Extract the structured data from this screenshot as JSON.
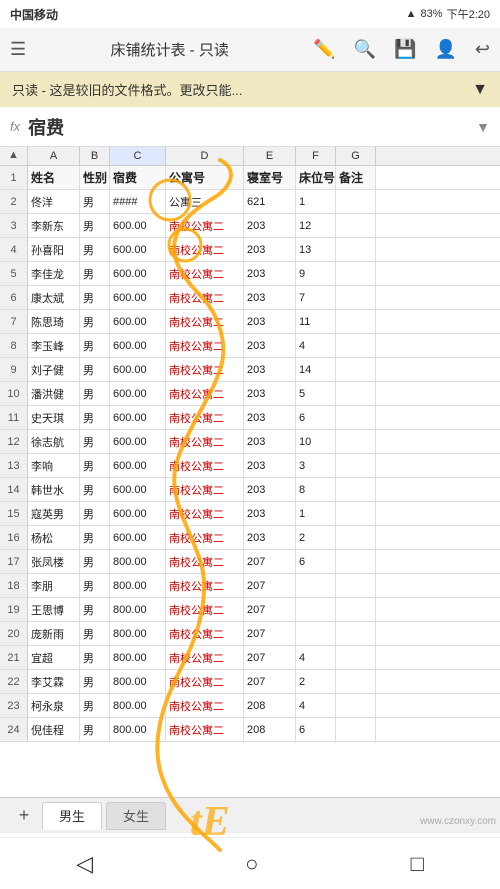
{
  "statusBar": {
    "carrier": "中国移动",
    "signal": "3G",
    "battery": "83%",
    "time": "下午2:20"
  },
  "titleBar": {
    "title": "床铺统计表 - 只读",
    "icons": [
      "edit",
      "search",
      "save",
      "user",
      "undo"
    ]
  },
  "readonlyBanner": {
    "text": "只读 - 这是较旧的文件格式。更改只能...",
    "expandIcon": "▼"
  },
  "formulaBar": {
    "fxLabel": "fx",
    "content": "宿费",
    "expandIcon": "▼"
  },
  "colHeaders": {
    "rowNum": "▲",
    "cols": [
      "A",
      "B",
      "C",
      "D",
      "E",
      "F",
      "G"
    ]
  },
  "rows": [
    {
      "num": "1",
      "a": "姓名",
      "b": "性别",
      "c": "宿费",
      "d": "公寓号",
      "e": "寝室号",
      "f": "床位号",
      "g": "备注",
      "header": true
    },
    {
      "num": "2",
      "a": "佟洋",
      "b": "男",
      "c": "####",
      "d": "公寓三",
      "e": "621",
      "f": "1",
      "g": ""
    },
    {
      "num": "3",
      "a": "李新东",
      "b": "男",
      "c": "600.00",
      "d": "南校公寓二",
      "e": "203",
      "f": "12",
      "g": ""
    },
    {
      "num": "4",
      "a": "孙喜阳",
      "b": "男",
      "c": "600.00",
      "d": "南校公寓二",
      "e": "203",
      "f": "13",
      "g": ""
    },
    {
      "num": "5",
      "a": "李佳龙",
      "b": "男",
      "c": "600.00",
      "d": "南校公寓二",
      "e": "203",
      "f": "9",
      "g": ""
    },
    {
      "num": "6",
      "a": "康太斌",
      "b": "男",
      "c": "600.00",
      "d": "南校公寓二",
      "e": "203",
      "f": "7",
      "g": ""
    },
    {
      "num": "7",
      "a": "陈思琦",
      "b": "男",
      "c": "600.00",
      "d": "南校公寓二",
      "e": "203",
      "f": "11",
      "g": ""
    },
    {
      "num": "8",
      "a": "李玉峰",
      "b": "男",
      "c": "600.00",
      "d": "南校公寓二",
      "e": "203",
      "f": "4",
      "g": ""
    },
    {
      "num": "9",
      "a": "刘子健",
      "b": "男",
      "c": "600.00",
      "d": "南校公寓二",
      "e": "203",
      "f": "14",
      "g": ""
    },
    {
      "num": "10",
      "a": "潘洪健",
      "b": "男",
      "c": "600.00",
      "d": "南校公寓二",
      "e": "203",
      "f": "5",
      "g": ""
    },
    {
      "num": "11",
      "a": "史天琪",
      "b": "男",
      "c": "600.00",
      "d": "南校公寓二",
      "e": "203",
      "f": "6",
      "g": ""
    },
    {
      "num": "12",
      "a": "徐志航",
      "b": "男",
      "c": "600.00",
      "d": "南校公寓二",
      "e": "203",
      "f": "10",
      "g": ""
    },
    {
      "num": "13",
      "a": "李响",
      "b": "男",
      "c": "600.00",
      "d": "南校公寓二",
      "e": "203",
      "f": "3",
      "g": ""
    },
    {
      "num": "14",
      "a": "韩世水",
      "b": "男",
      "c": "600.00",
      "d": "南校公寓二",
      "e": "203",
      "f": "8",
      "g": ""
    },
    {
      "num": "15",
      "a": "寇英男",
      "b": "男",
      "c": "600.00",
      "d": "南校公寓二",
      "e": "203",
      "f": "1",
      "g": ""
    },
    {
      "num": "16",
      "a": "杨松",
      "b": "男",
      "c": "600.00",
      "d": "南校公寓二",
      "e": "203",
      "f": "2",
      "g": ""
    },
    {
      "num": "17",
      "a": "张凤楼",
      "b": "男",
      "c": "800.00",
      "d": "南校公寓二",
      "e": "207",
      "f": "6",
      "g": ""
    },
    {
      "num": "18",
      "a": "李朋",
      "b": "男",
      "c": "800.00",
      "d": "南校公寓二",
      "e": "207",
      "f": "",
      "g": ""
    },
    {
      "num": "19",
      "a": "王思博",
      "b": "男",
      "c": "800.00",
      "d": "南校公寓二",
      "e": "207",
      "f": "",
      "g": ""
    },
    {
      "num": "20",
      "a": "庞新雨",
      "b": "男",
      "c": "800.00",
      "d": "南校公寓二",
      "e": "207",
      "f": "",
      "g": ""
    },
    {
      "num": "21",
      "a": "宜超",
      "b": "男",
      "c": "800.00",
      "d": "南校公寓二",
      "e": "207",
      "f": "4",
      "g": ""
    },
    {
      "num": "22",
      "a": "李艾霖",
      "b": "男",
      "c": "800.00",
      "d": "南校公寓二",
      "e": "207",
      "f": "2",
      "g": ""
    },
    {
      "num": "23",
      "a": "柯永泉",
      "b": "男",
      "c": "800.00",
      "d": "南校公寓二",
      "e": "208",
      "f": "4",
      "g": ""
    },
    {
      "num": "24",
      "a": "倪佳程",
      "b": "男",
      "c": "800.00",
      "d": "南校公寓二",
      "e": "208",
      "f": "6",
      "g": ""
    }
  ],
  "tabs": [
    {
      "label": "男生",
      "active": true
    },
    {
      "label": "女生",
      "active": false
    }
  ],
  "navBar": {
    "back": "◁",
    "home": "○",
    "recent": "□"
  },
  "watermark": "www.czonxy.com"
}
